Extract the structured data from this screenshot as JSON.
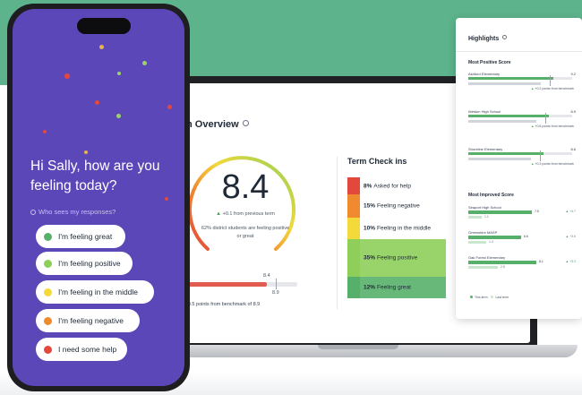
{
  "colors": {
    "background_band": "#5db38c",
    "phone_screen": "#5b47b8",
    "great": "#57b06a",
    "positive": "#8ecf5a",
    "middle": "#f3d93a",
    "negative": "#f08a2e",
    "help": "#e2483b"
  },
  "phone": {
    "greeting": "Hi Sally, how are you feeling today?",
    "who_sees": "Who sees my responses?",
    "options": [
      {
        "label": "I'm feeling great",
        "color": "#57b06a"
      },
      {
        "label": "I'm feeling positive",
        "color": "#8ecf5a"
      },
      {
        "label": "I'm feeling in the middle",
        "color": "#f3d93a"
      },
      {
        "label": "I'm feeling negative",
        "color": "#f08a2e"
      },
      {
        "label": "I need some help",
        "color": "#e2483b"
      }
    ]
  },
  "overview": {
    "title": "n Overview",
    "score": "8.4",
    "delta": "+0.1 from previous term",
    "positive_note": "62% district students are feeling positive or great",
    "benchmark_value": "8.4",
    "benchmark_ref": "8.9",
    "benchmark_note": "-0.5 points from benchmark of 8.9"
  },
  "term_checkins": {
    "title": "Term Check ins",
    "rows": [
      {
        "pct": "8%",
        "label": "Asked for help",
        "color": "#e2483b"
      },
      {
        "pct": "15%",
        "label": "Feeling negative",
        "color": "#f08a2e"
      },
      {
        "pct": "10%",
        "label": "Feeling in the middle",
        "color": "#f3d93a"
      },
      {
        "pct": "35%",
        "label": "Feeling positive",
        "color": "#8ecf5a"
      },
      {
        "pct": "12%",
        "label": "Feeling great",
        "color": "#57b06a"
      }
    ]
  },
  "highlights": {
    "title": "Highlights",
    "most_positive_title": "Most Positive Score",
    "most_positive": [
      {
        "name": "Ashford Elementary",
        "value": "9.2",
        "sub": "+0.2 points",
        "sub2": "from benchmark",
        "fill": 0.82
      },
      {
        "name": "Weston High School",
        "value": "8.9",
        "sub": "+0.8 points",
        "sub2": "from benchmark",
        "fill": 0.78
      },
      {
        "name": "Shoreline Elementary",
        "value": "8.6",
        "sub": "+0.3 points",
        "sub2": "from benchmark",
        "fill": 0.72
      }
    ],
    "most_improved_title": "Most Improved Score",
    "most_improved": [
      {
        "name": "Seaport High School",
        "now": "7.5",
        "before": "1.1",
        "delta": "+4.7",
        "fill": 0.6,
        "fill2": 0.13
      },
      {
        "name": "Greenshire MASP",
        "now": "6.6",
        "before": "1.4",
        "delta": "+3.6",
        "fill": 0.5,
        "fill2": 0.17
      },
      {
        "name": "Oak Forest Elementary",
        "now": "8.1",
        "before": "2.5",
        "delta": "+3.3",
        "fill": 0.64,
        "fill2": 0.28
      }
    ],
    "legend_this": "This term",
    "legend_last": "Last term"
  }
}
